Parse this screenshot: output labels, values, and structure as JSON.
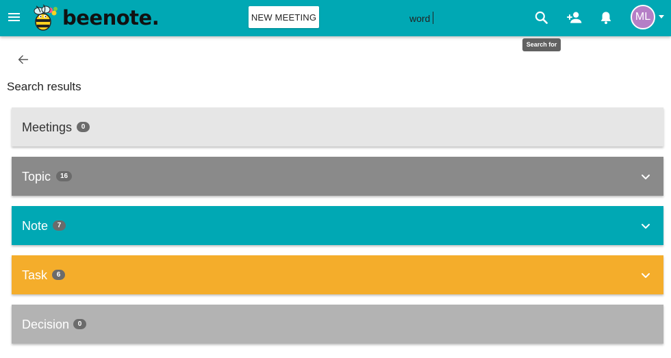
{
  "app": {
    "logo_text": "beenote",
    "logo_dot": "."
  },
  "header": {
    "new_meeting_label": "NEW MEETING",
    "search_value": "word",
    "search_tooltip": "Search for",
    "avatar_initials": "ML",
    "icons": [
      "menu-icon",
      "search-icon",
      "add-user-icon",
      "bell-icon",
      "chevron-down-icon"
    ]
  },
  "page": {
    "title": "Search results"
  },
  "results": [
    {
      "label": "Meetings",
      "count": "0",
      "bg": "#e6e6e6",
      "color": "#333333",
      "expandable": false
    },
    {
      "label": "Topic",
      "count": "16",
      "bg": "#8a8a8a",
      "color": "#ffffff",
      "expandable": true
    },
    {
      "label": "Note",
      "count": "7",
      "bg": "#00a8b4",
      "color": "#ffffff",
      "expandable": true
    },
    {
      "label": "Task",
      "count": "6",
      "bg": "#f4ad2b",
      "color": "#ffffff",
      "expandable": true
    },
    {
      "label": "Decision",
      "count": "0",
      "bg": "#b3b3b3",
      "color": "#ffffff",
      "expandable": false
    }
  ],
  "colors": {
    "header_bg": "#00a8b4",
    "avatar_bg": "#b57fc6",
    "badge_bg": "#6b6b6b"
  }
}
